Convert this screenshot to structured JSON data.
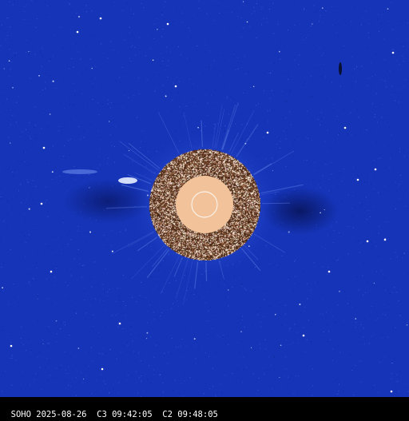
{
  "image": {
    "caption": "SOHO 2025-08-26  C3 09:42:05  C2 09:48:05"
  },
  "colors": {
    "background": "#1534b8",
    "sun_disk": "#f2c39a",
    "occulter_base": "#5a3522",
    "footer": "#000000",
    "text": "#ffffff"
  }
}
